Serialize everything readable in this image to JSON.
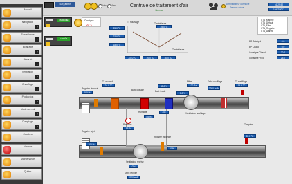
{
  "header": {
    "title": "Centrale de traitement d'air",
    "subtitle": "Normal",
    "user_label": "Sub_admin",
    "radio_1": "Auto",
    "radio_2": "Manu",
    "right_info_1": "Administrateur connecté",
    "right_info_2": "Session active",
    "right_time": "16:29:52",
    "right_date": "18/07/2017"
  },
  "sidebar": {
    "items": [
      {
        "label": "Accueil",
        "icon": "home-icon"
      },
      {
        "label": "Navigation",
        "icon": "map-icon"
      },
      {
        "label": "Surveillance",
        "icon": "monitor-icon"
      },
      {
        "label": "Éclairage",
        "icon": "light-icon"
      },
      {
        "label": "Sécurité",
        "icon": "shield-icon"
      },
      {
        "label": "Ventilation",
        "icon": "fan-icon"
      },
      {
        "label": "Chauffage",
        "icon": "heat-icon"
      },
      {
        "label": "Production",
        "icon": "factory-icon"
      },
      {
        "label": "Mode normal",
        "icon": "mode-icon"
      },
      {
        "label": "Comptage",
        "icon": "counter-icon"
      },
      {
        "label": "Courbes",
        "icon": "curve-icon"
      },
      {
        "label": "Alarmes",
        "icon": "alarm-icon"
      },
      {
        "label": "Maintenance",
        "icon": "tools-icon"
      },
      {
        "label": "Quitter",
        "icon": "exit-icon"
      }
    ]
  },
  "left_controls": {
    "box1_status": "MARCHE",
    "box2_status": "ARRÊT",
    "setpoint_label": "Consigne",
    "setpoint_value": "20 °C"
  },
  "graph": {
    "label_left": "T° soufflage",
    "label_right": "T° extérieure",
    "x_label": "T° extérieure",
    "values_left": [
      "25.0 °C",
      "22.0 °C",
      "18.0 °C"
    ],
    "values_right": [
      "25.0 °C"
    ],
    "values_bottom": [
      "-10.0 °C",
      "20.0 °C",
      "30.0 °C"
    ]
  },
  "right_panel": {
    "legend": [
      "CTA_Marche",
      "CTA_Défaut",
      "CTA_Filtre",
      "CTA_Registre",
      "CTA_Alarme"
    ],
    "rows": [
      {
        "label": "BP Prérégul.",
        "value": "0.0"
      },
      {
        "label": "BP Chaud",
        "value": "0.0"
      },
      {
        "label": "Consigne Chaud",
        "value": "20.0"
      },
      {
        "label": "Consigne Froid",
        "value": "26.0"
      }
    ]
  },
  "synoptic": {
    "top_labels": [
      "T° air neuf",
      "Batt. chaude",
      "Batt. froide",
      "Filtre",
      "Débit soufflage",
      "T° soufflage"
    ],
    "top_values": [
      "24.0 °C",
      "45.0 %",
      "0.0 %",
      "120 Pa",
      "3200 m³/h",
      "19.5 °C"
    ],
    "mid_labels": [
      "Registre air neuf",
      "Ventilateur soufflage",
      "Humidité",
      "Pression"
    ],
    "mid_values": [
      "100 %",
      "ON",
      "55 %",
      "85 Pa"
    ],
    "bottom_labels": [
      "Registre rejet",
      "Ventilateur reprise",
      "T° reprise",
      "Débit reprise"
    ],
    "bottom_values": [
      "100 %",
      "ON",
      "22.0 °C",
      "3100 m³/h"
    ],
    "mix_label": "Registre mélange",
    "mix_value": "0 %"
  }
}
